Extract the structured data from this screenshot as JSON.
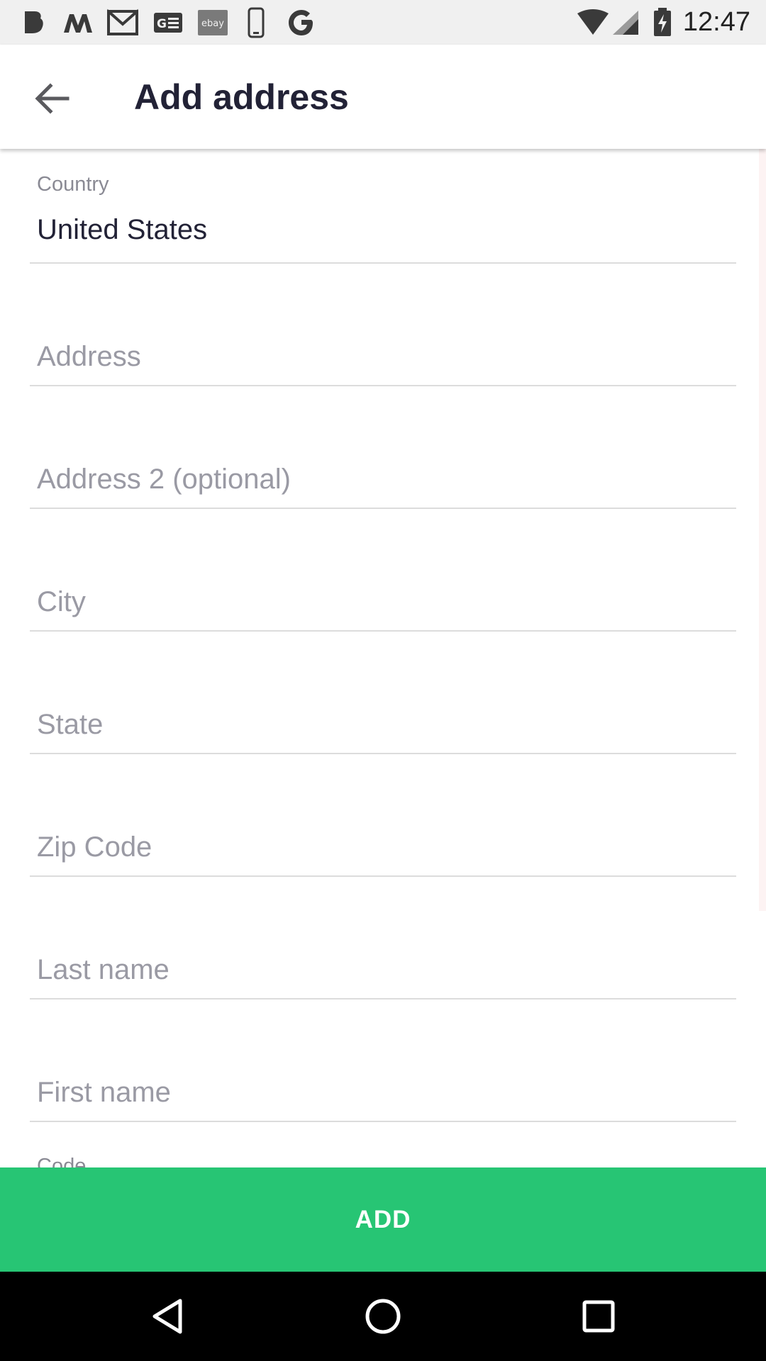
{
  "status_bar": {
    "time": "12:47",
    "notification_icons": [
      "bold-b-icon",
      "m-logo-icon",
      "gmail-icon",
      "news-icon",
      "ebay-icon",
      "phone-icon",
      "google-icon"
    ],
    "ebay_text": "ebay",
    "system_icons": [
      "wifi-icon",
      "signal-icon",
      "battery-charging-icon"
    ]
  },
  "app_bar": {
    "back_icon": "arrow-back-icon",
    "title": "Add address"
  },
  "form": {
    "country": {
      "label": "Country",
      "value": "United States"
    },
    "address": {
      "placeholder": "Address"
    },
    "address2": {
      "placeholder": "Address 2 (optional)"
    },
    "city": {
      "placeholder": "City"
    },
    "state": {
      "placeholder": "State"
    },
    "zip": {
      "placeholder": "Zip Code"
    },
    "last_name": {
      "placeholder": "Last name"
    },
    "first_name": {
      "placeholder": "First name"
    },
    "code": {
      "label": "Code"
    }
  },
  "actions": {
    "add_label": "ADD"
  },
  "colors": {
    "accent": "#27c574",
    "title_text": "#222236",
    "placeholder_text": "#9a9aa4",
    "divider": "#dcdcdc"
  },
  "nav_bar": {
    "icons": [
      "back-triangle-icon",
      "home-circle-icon",
      "recents-square-icon"
    ]
  }
}
